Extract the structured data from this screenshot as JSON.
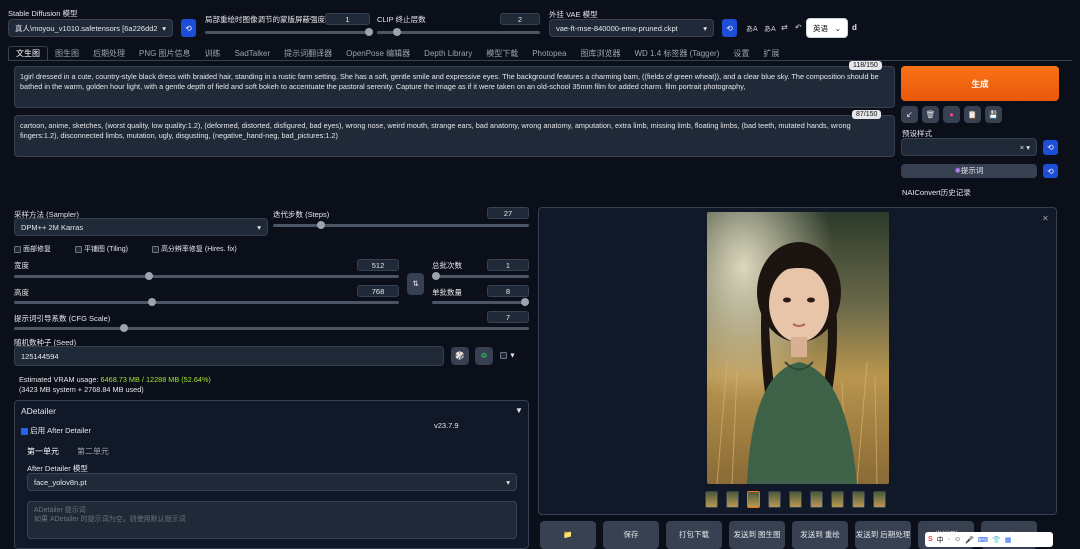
{
  "top": {
    "model_label": "Stable Diffusion 模型",
    "model_value": "真人\\moyou_v1010.safetensors [6a226dd2",
    "attn_label": "局部重绘时图像调节的蒙版屏蔽强度",
    "attn_value": "1",
    "clip_label": "CLIP 终止层数",
    "clip_value": "2",
    "vae_label": "外挂 VAE 模型",
    "vae_value": "vae-ft-mse-840000-ema-pruned.ckpt",
    "lang_value": "英语",
    "extra_d": "d"
  },
  "tabs": [
    "文生图",
    "图生图",
    "后期处理",
    "PNG 图片信息",
    "训练",
    "SadTalker",
    "提示词翻译器",
    "OpenPose 编辑器",
    "Depth Library",
    "模型下载",
    "Photopea",
    "图库浏览器",
    "WD 1.4 标签器 (Tagger)",
    "设置",
    "扩展"
  ],
  "prompt": {
    "counter": "118/150",
    "text": "1girl dressed in a cute, country-style black dress with braided hair, standing in a rustic farm setting. She has a soft, gentle smile and expressive eyes. The background features a charming barn, ((fields of green wheat)), and a clear blue sky. The composition should be bathed in the warm, golden hour light, with a gentle depth of field and soft bokeh to accentuate the pastoral serenity. Capture the image as if it were taken on an old-school 35mm film for added charm. film portrait photography,"
  },
  "negative": {
    "counter": "87/150",
    "text": "cartoon, anime, sketches, (worst quality, low quality:1.2), (deformed, distorted, disfigured, bad eyes), wrong nose, weird mouth, strange ears, bad anatomy, wrong anatomy, amputation, extra limb, missing limb, floating limbs, (bad teeth, mutated hands, wrong fingers:1.2), disconnected limbs, mutation, ugly, disgusting,  (negative_hand-neg, bad_pictures:1.2)"
  },
  "right": {
    "generate": "生成",
    "style_label": "预设样式",
    "prompt_btn": "提示词",
    "nai_label": "NAIConvert历史记录"
  },
  "params": {
    "sampler_label": "采样方法 (Sampler)",
    "sampler_value": "DPM++ 2M Karras",
    "steps_label": "迭代步数 (Steps)",
    "steps_value": "27",
    "face_restore": "面部修复",
    "tiling": "平铺图 (Tiling)",
    "hires": "高分辨率修复 (Hires. fix)",
    "width_label": "宽度",
    "width_value": "512",
    "height_label": "高度",
    "height_value": "768",
    "batch_count_label": "总批次数",
    "batch_count_value": "1",
    "batch_size_label": "单批数量",
    "batch_size_value": "8",
    "cfg_label": "提示词引导系数 (CFG Scale)",
    "cfg_value": "7",
    "seed_label": "随机数种子 (Seed)",
    "seed_value": "125144594"
  },
  "vram": {
    "line1_prefix": "Estimated VRAM usage: ",
    "line1_value": "6468.73 MB / 12288 MB (52.64%)",
    "line2": "(3423 MB system + 2768.84 MB used)"
  },
  "adetailer": {
    "title": "ADetailer",
    "enable": "启用 After Detailer",
    "version": "v23.7.9",
    "tab1": "第一单元",
    "tab2": "第二单元",
    "model_label": "After Detailer 模型",
    "model_value": "face_yolov8n.pt",
    "prompt_placeholder_1": "ADetailer 提示词",
    "prompt_placeholder_2": "如果 ADetailer 的提示词为空，则使用默认提示词"
  },
  "bottom_buttons": [
    "保存",
    "打包下载",
    "发送到 图生图",
    "发送到 重绘",
    "发送到 后期处理",
    "发送到",
    "Send to"
  ],
  "ime": [
    "中",
    "·",
    "☺"
  ],
  "colors": {
    "accent": "#f97316",
    "vram_green": "#a3e635",
    "blue": "#1d4ed8"
  },
  "sliders": {
    "attn": 1.0,
    "clip": 0.2,
    "steps": 0.18,
    "width": 0.35,
    "height": 0.6,
    "batch_count": 0.0,
    "batch_size": 1.0,
    "cfg": 0.21
  }
}
